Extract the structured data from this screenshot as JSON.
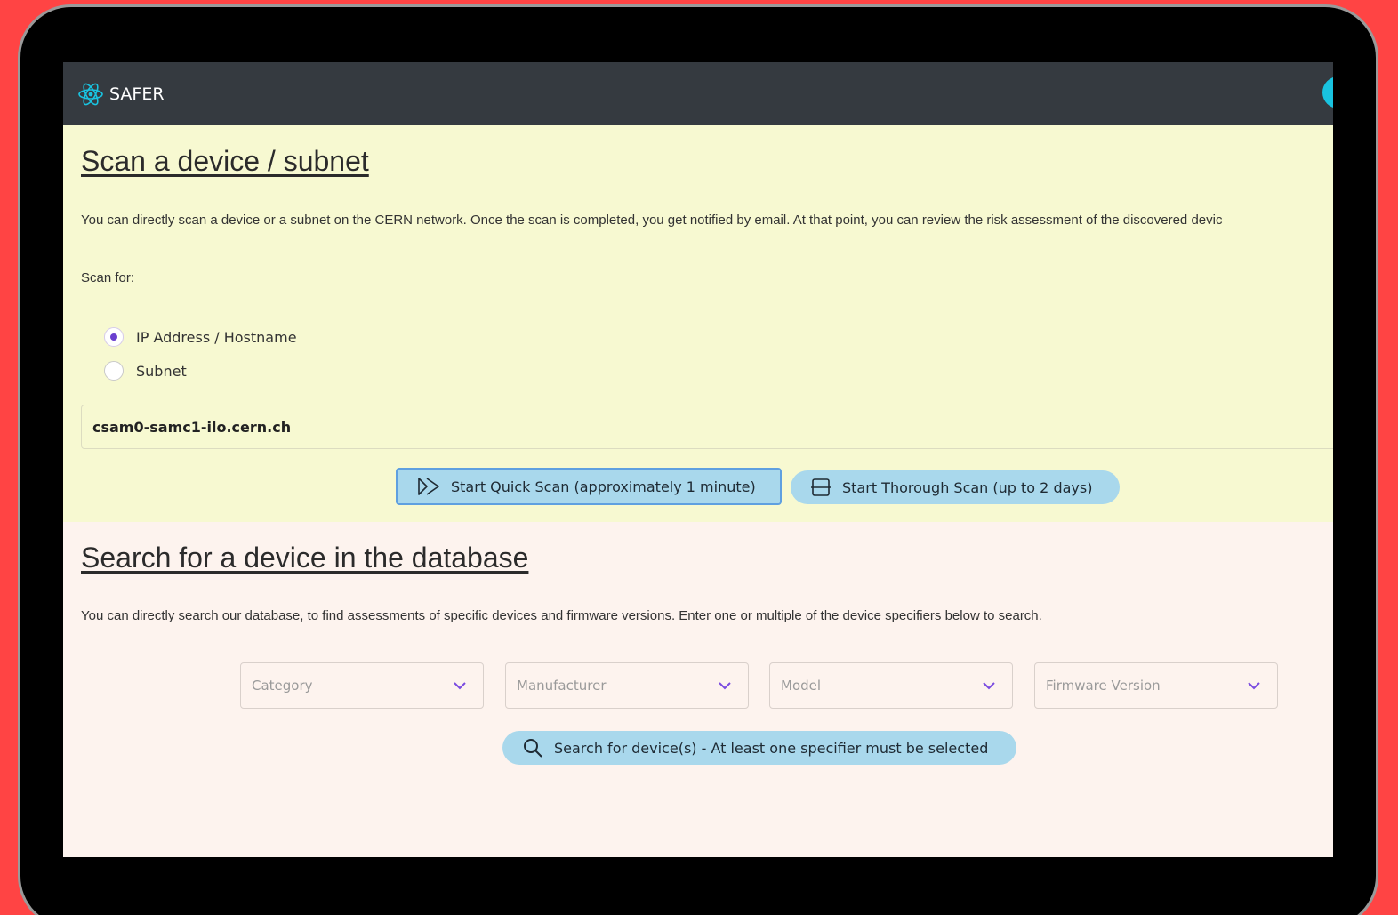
{
  "app": {
    "brand": "SAFER",
    "brand_color": "#19c3e0"
  },
  "scan": {
    "title": "Scan a device / subnet",
    "description": "You can directly scan a device or a subnet on the CERN network. Once the scan is completed, you get notified by email. At that point, you can review the risk assessment of the discovered devic",
    "scan_for_label": "Scan for:",
    "options": [
      {
        "label": "IP Address / Hostname",
        "selected": true
      },
      {
        "label": "Subnet",
        "selected": false
      }
    ],
    "input_value": "csam0-samc1-ilo.cern.ch",
    "quick_scan_label": "Start Quick Scan (approximately 1 minute)",
    "thorough_scan_label": "Start Thorough Scan (up to 2 days)"
  },
  "search": {
    "title": "Search for a device in the database",
    "description": "You can directly search our database, to find assessments of specific devices and firmware versions. Enter one or multiple of the device specifiers below to search.",
    "selects": [
      {
        "placeholder": "Category"
      },
      {
        "placeholder": "Manufacturer"
      },
      {
        "placeholder": "Model"
      },
      {
        "placeholder": "Firmware Version"
      }
    ],
    "search_button_label": "Search for device(s) - At least one specifier must be selected"
  },
  "colors": {
    "navbar": "#353a40",
    "scan_bg": "#f7f9d1",
    "search_bg": "#fdf3ee",
    "button_bg": "#a9d8ec",
    "radio_accent": "#6a3fcf",
    "chevron": "#7a4be0"
  }
}
